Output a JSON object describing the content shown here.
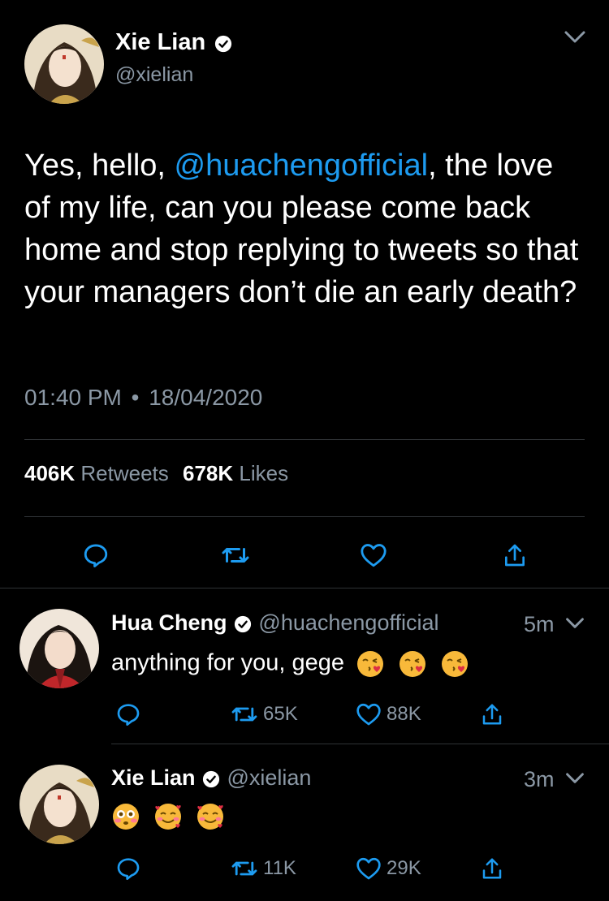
{
  "main_tweet": {
    "author_name": "Xie Lian",
    "author_handle": "@xielian",
    "text_before": "Yes, hello, ",
    "mention": "@huachengofficial",
    "text_after": ", the love of my life, can you please come back home and stop replying to tweets so that your managers don’t die an early death?",
    "time": "01:40 PM",
    "date": "18/04/2020",
    "separator": "•",
    "retweets_count": "406K",
    "retweets_label": "Retweets",
    "likes_count": "678K",
    "likes_label": "Likes"
  },
  "replies": [
    {
      "author_name": "Hua Cheng",
      "author_handle": "@huachengofficial",
      "time": "5m",
      "text": "anything for you, gege",
      "emojis": [
        "kissing-heart",
        "kissing-heart",
        "kissing-heart"
      ],
      "retweets": "65K",
      "likes": "88K"
    },
    {
      "author_name": "Xie Lian",
      "author_handle": "@xielian",
      "time": "3m",
      "text": "",
      "emojis": [
        "flushed-face",
        "smiling-hearts",
        "smiling-hearts"
      ],
      "retweets": "11K",
      "likes": "29K"
    }
  ],
  "colors": {
    "background": "#000000",
    "accent": "#1d9bf0",
    "secondary_text": "#8b98a5",
    "divider": "#2f3336"
  },
  "icons": [
    "verified-badge-icon",
    "chevron-down-icon",
    "reply-icon",
    "retweet-icon",
    "like-icon",
    "share-icon"
  ]
}
